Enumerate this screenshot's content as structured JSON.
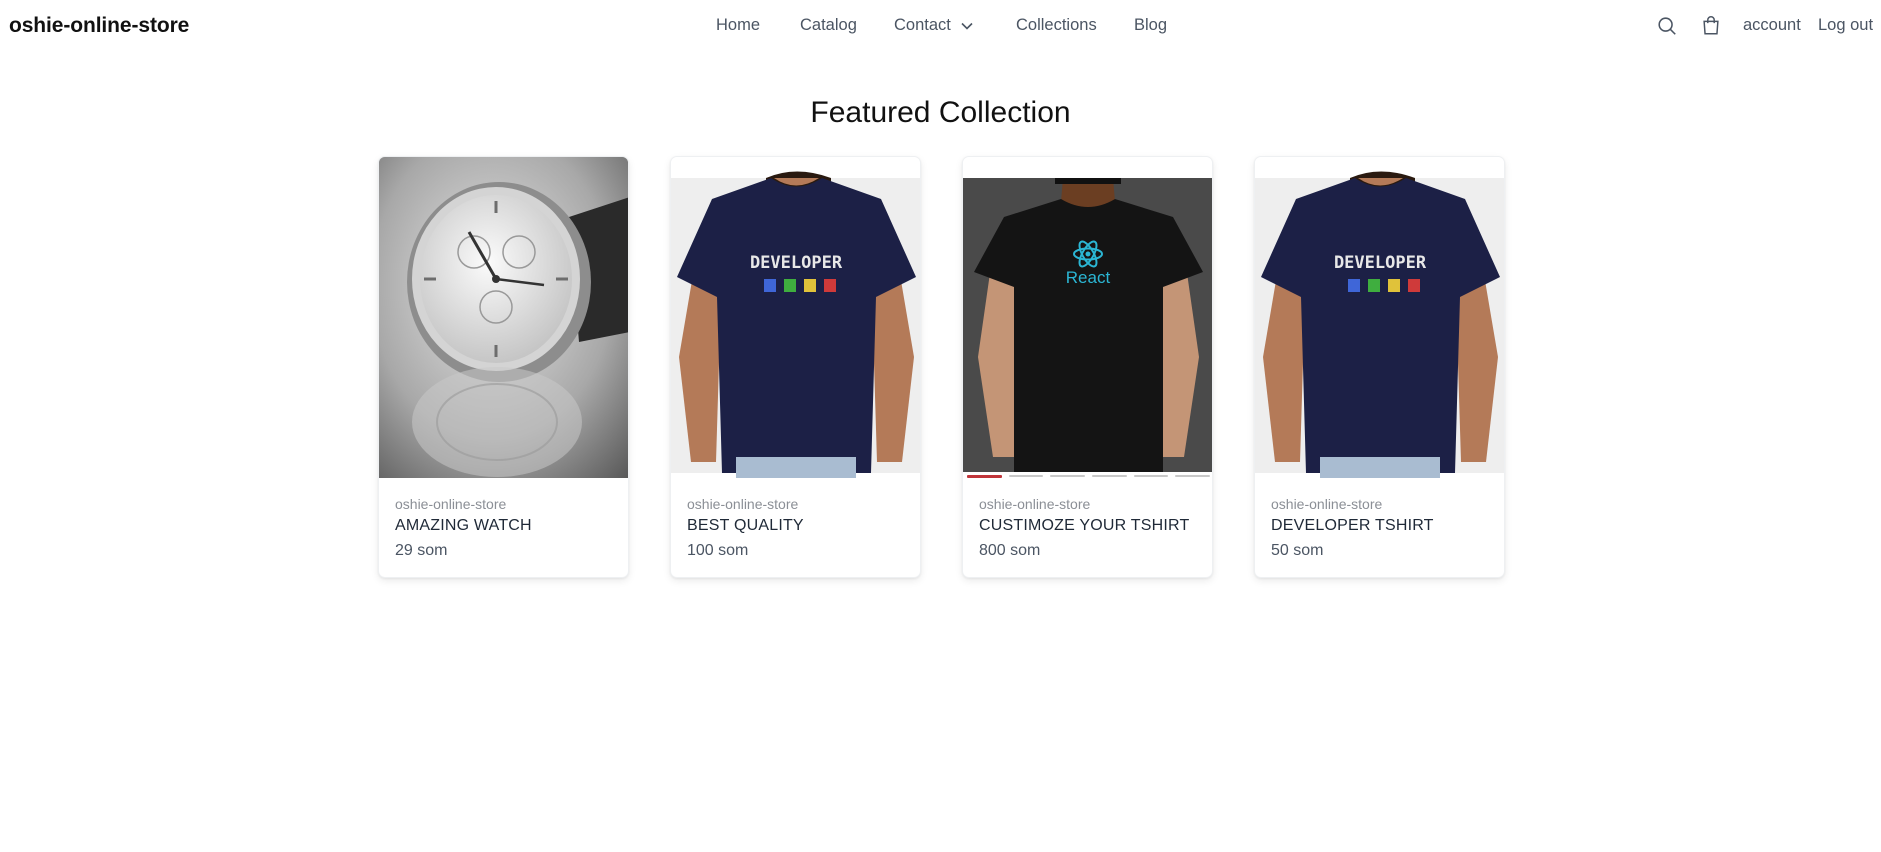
{
  "header": {
    "logo": "oshie-online-store",
    "nav": [
      {
        "label": "Home"
      },
      {
        "label": "Catalog"
      },
      {
        "label": "Contact"
      },
      {
        "label": "Collections"
      },
      {
        "label": "Blog"
      }
    ],
    "actions": {
      "search_icon": "search-icon",
      "cart_icon": "shopping-bag-icon",
      "account_label": "account",
      "logout_label": "Log out"
    }
  },
  "section": {
    "title": "Featured Collection"
  },
  "products": [
    {
      "vendor": "oshie-online-store",
      "title": "AMAZING WATCH",
      "price": "29 som",
      "image": "wristwatch"
    },
    {
      "vendor": "oshie-online-store",
      "title": "BEST QUALITY",
      "price": "100 som",
      "image": "developer-tshirt"
    },
    {
      "vendor": "oshie-online-store",
      "title": "CUSTIMOZE YOUR TSHIRT",
      "price": "800 som",
      "image": "react-tshirt"
    },
    {
      "vendor": "oshie-online-store",
      "title": "DEVELOPER TSHIRT",
      "price": "50 som",
      "image": "developer-tshirt"
    }
  ],
  "product_image_text": {
    "developer": "DEVELOPER",
    "react": "React"
  },
  "carousel": {
    "slides": 6,
    "active": 1
  },
  "colors": {
    "tshirt_navy": "#1c2046",
    "tshirt_black": "#141414",
    "react_cyan": "#2bb6d4",
    "active_indicator": "#c0353a"
  }
}
